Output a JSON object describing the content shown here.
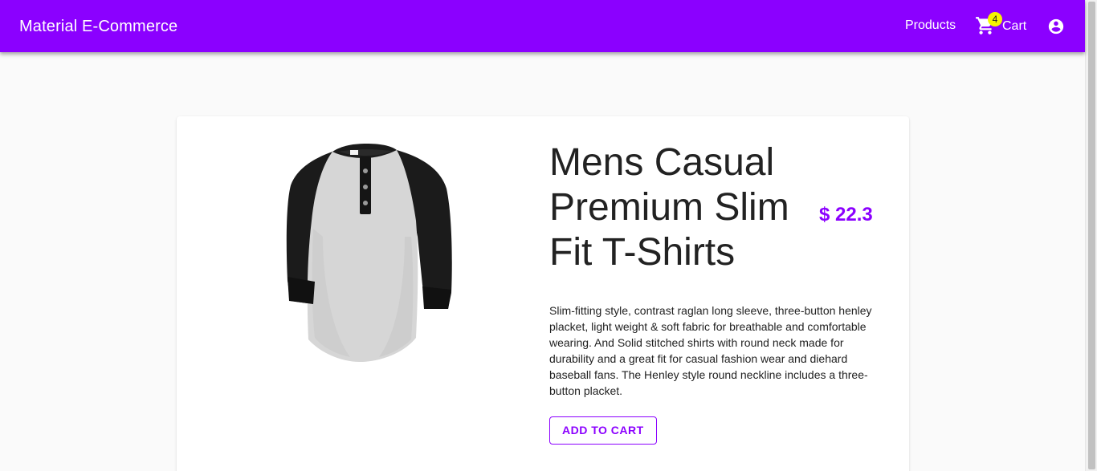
{
  "app": {
    "title": "Material E-Commerce",
    "brand_color": "#8b00ff"
  },
  "nav": {
    "products_label": "Products",
    "cart_label": "Cart",
    "cart_count": "4",
    "cart_icon": "cart-icon",
    "account_icon": "account-circle-icon",
    "badge_color": "#f5f500"
  },
  "product": {
    "title": "Mens Casual Premium Slim Fit T-Shirts",
    "price": "$ 22.3",
    "description": "Slim-fitting style, contrast raglan long sleeve, three-button henley placket, light weight & soft fabric for breathable and comfortable wearing. And Solid stitched shirts with round neck made for durability and a great fit for casual fashion wear and diehard baseball fans. The Henley style round neckline includes a three-button placket.",
    "add_to_cart_label": "Add to cart",
    "image": "raglan-henley-shirt-image"
  }
}
